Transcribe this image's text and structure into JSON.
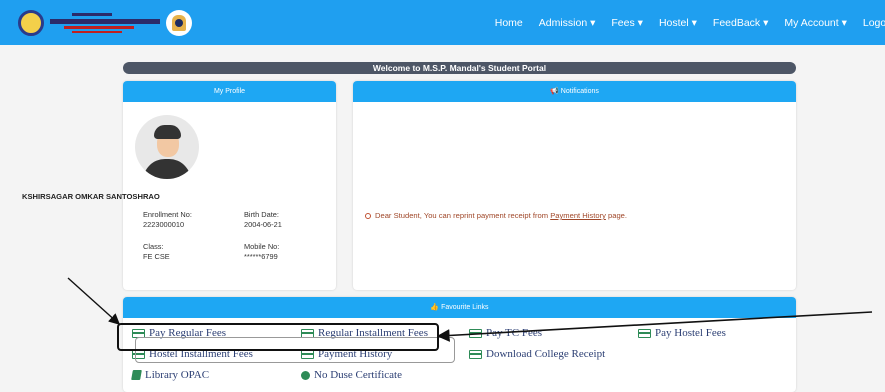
{
  "nav": [
    "Home",
    "Admission",
    "Fees",
    "Hostel",
    "FeedBack",
    "My Account",
    "Logout"
  ],
  "nav_dropdown_marks": [
    false,
    true,
    true,
    true,
    true,
    true,
    false
  ],
  "welcome": "Welcome to M.S.P. Mandal's Student Portal",
  "profile": {
    "title": "My Profile",
    "name": "KSHIRSAGAR OMKAR SANTOSHRAO",
    "enrollment_label": "Enrollment No:",
    "enrollment": "2223000010",
    "birth_label": "Birth Date:",
    "birth": "2004-06-21",
    "class_label": "Class:",
    "class": "FE CSE",
    "mobile_label": "Mobile No:",
    "mobile": "******6799"
  },
  "notifications": {
    "title": "Notifications",
    "message_pre": "Dear Student, You can reprint payment receipt from ",
    "message_link": "Payment History",
    "message_post": " page."
  },
  "favourites": {
    "title": "Favourite Links",
    "links": [
      {
        "label": "Pay Regular Fees",
        "icon": "card-icon"
      },
      {
        "label": "Regular Installment Fees",
        "icon": "card-icon"
      },
      {
        "label": "Pay TC Fees",
        "icon": "card-icon"
      },
      {
        "label": "Pay Hostel Fees",
        "icon": "card-icon"
      },
      {
        "label": "Hostel Installment Fees",
        "icon": "card-icon"
      },
      {
        "label": "Payment History",
        "icon": "card-icon"
      },
      {
        "label": "Download College Receipt",
        "icon": "card-icon"
      },
      {
        "label": "Library OPAC",
        "icon": "book-icon"
      },
      {
        "label": "No Duse Certificate",
        "icon": "circle-icon"
      }
    ]
  },
  "colors": {
    "header": "#1f9ff0",
    "card_head": "#1ea7f3",
    "link": "#2b3e73",
    "icon": "#2e8b57"
  }
}
